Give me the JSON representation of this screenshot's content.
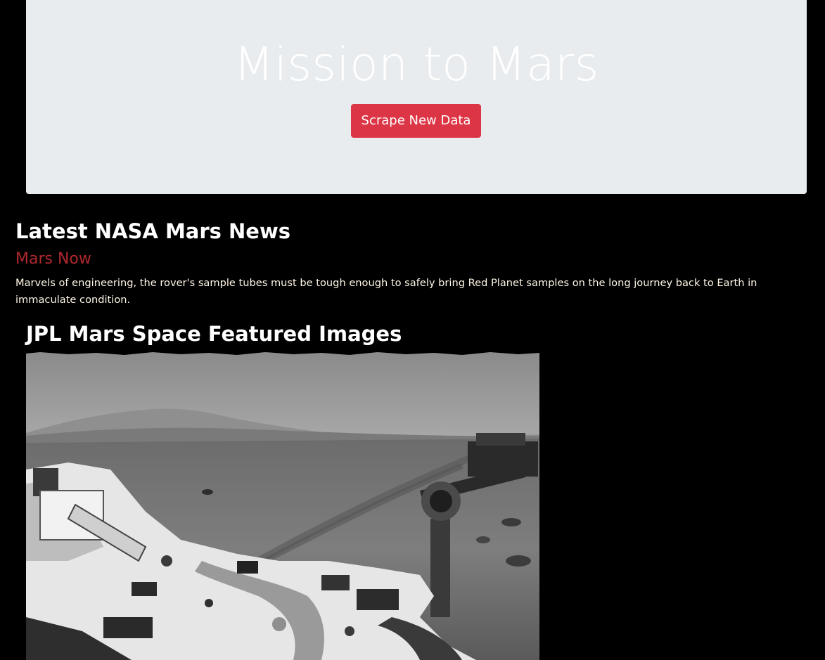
{
  "jumbotron": {
    "title": "Mission to Mars",
    "button_label": "Scrape New Data"
  },
  "news": {
    "heading": "Latest NASA Mars News",
    "title": "Mars Now",
    "paragraph": "Marvels of engineering, the rover's sample tubes must be tough enough to safely bring Red Planet samples on the long journey back to Earth in immaculate condition."
  },
  "featured": {
    "heading": "JPL Mars Space Featured Images"
  },
  "colors": {
    "page_background": "#000000",
    "jumbotron_background": "#e9ecef",
    "button_danger": "#dc3545",
    "news_title": "#b0282d"
  }
}
